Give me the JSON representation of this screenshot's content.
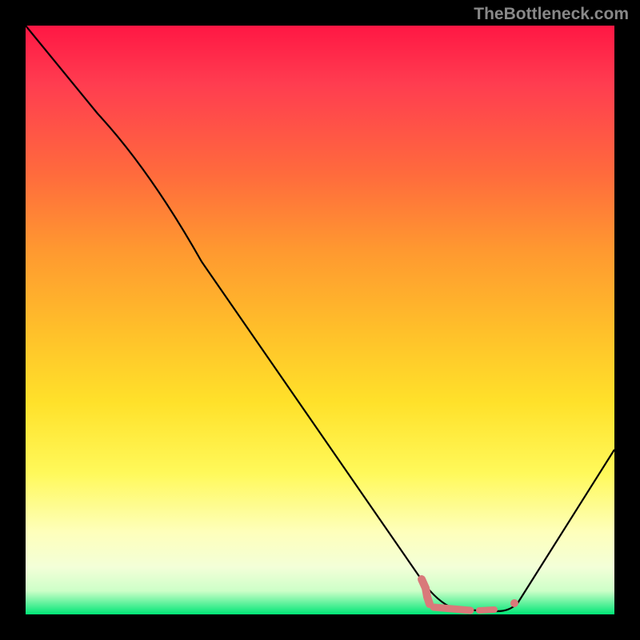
{
  "watermark": "TheBottleneck.com",
  "chart_data": {
    "type": "line",
    "title": "",
    "xlabel": "",
    "ylabel": "",
    "xlim": [
      0,
      100
    ],
    "ylim": [
      0,
      100
    ],
    "series": [
      {
        "name": "bottleneck-curve",
        "x": [
          0,
          12,
          30,
          68,
          72,
          80,
          83,
          100
        ],
        "y": [
          100,
          85,
          73,
          7,
          2,
          1,
          2,
          28
        ],
        "color": "#000000"
      }
    ],
    "markers": [
      {
        "name": "marker-region-tall",
        "x": 67,
        "y": 7,
        "color": "#d9797a"
      },
      {
        "name": "marker-region-flat",
        "x": 75,
        "y": 2,
        "color": "#d9797a"
      },
      {
        "name": "marker-dot",
        "x": 83,
        "y": 2.5,
        "color": "#d9797a"
      }
    ],
    "background_gradient": {
      "top": "#ff1744",
      "mid": "#ffe12a",
      "bottom": "#00e676"
    }
  }
}
